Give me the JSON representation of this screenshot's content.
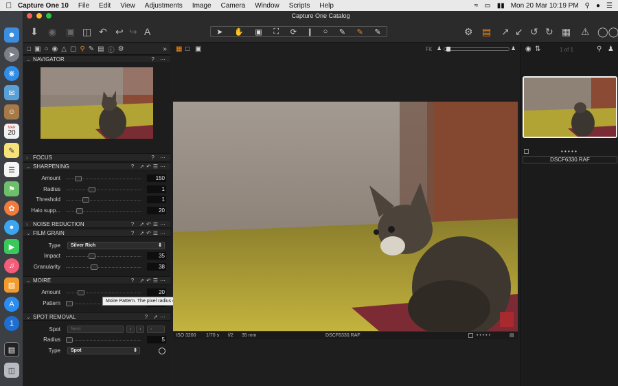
{
  "menubar": {
    "app_name": "Capture One 10",
    "items": [
      "File",
      "Edit",
      "View",
      "Adjustments",
      "Image",
      "Camera",
      "Window",
      "Scripts",
      "Help"
    ],
    "clock": "Mon 20 Mar  10:19 PM"
  },
  "window": {
    "title": "Capture One Catalog"
  },
  "dock": {
    "calendar_day": "20",
    "calendar_month": "MAR"
  },
  "viewer": {
    "fit_label": "Fit",
    "count_label": "1 of 1",
    "iso": "ISO 3200",
    "shutter": "1/70 s",
    "aperture": "f/2",
    "focal": "35 mm",
    "filename": "DSCF6330.RAF",
    "dots": "• • • • •"
  },
  "browser": {
    "filename": "DSCF6330.RAF",
    "dots": "• • • • •"
  },
  "panels": {
    "navigator": "NAVIGATOR",
    "focus": "FOCUS",
    "sharpening": {
      "title": "SHARPENING",
      "amount_label": "Amount",
      "amount": "150",
      "amount_level": 0.13,
      "radius_label": "Radius",
      "radius": "1",
      "radius_level": 0.33,
      "threshold_label": "Threshold",
      "threshold": "1",
      "threshold_level": 0.24,
      "halo_label": "Halo supp...",
      "halo": "20",
      "halo_level": 0.15
    },
    "noise_reduction": "NOISE REDUCTION",
    "film_grain": {
      "title": "FILM GRAIN",
      "type_label": "Type",
      "type_value": "Silver Rich",
      "impact_label": "Impact",
      "impact": "35",
      "impact_level": 0.33,
      "granularity_label": "Granularity",
      "granularity": "38",
      "granularity_level": 0.36
    },
    "moire": {
      "title": "MOIRE",
      "amount_label": "Amount",
      "amount": "20",
      "amount_level": 0.17,
      "pattern_label": "Pattern",
      "pattern": "8",
      "pattern_level": 0.0
    },
    "spot_removal": {
      "title": "SPOT REMOVAL",
      "spot_label": "Spot",
      "spot_next": "Next",
      "radius_label": "Radius",
      "radius": "5",
      "radius_level": 0.0,
      "type_label": "Type",
      "type_value": "Spot"
    }
  },
  "tooltip": "Moire Pattern. The pixel radius of the search pattern.",
  "colors": {
    "accent": "#f0891e",
    "panel_bg": "#1d1d1d",
    "header_bg": "#262626"
  }
}
